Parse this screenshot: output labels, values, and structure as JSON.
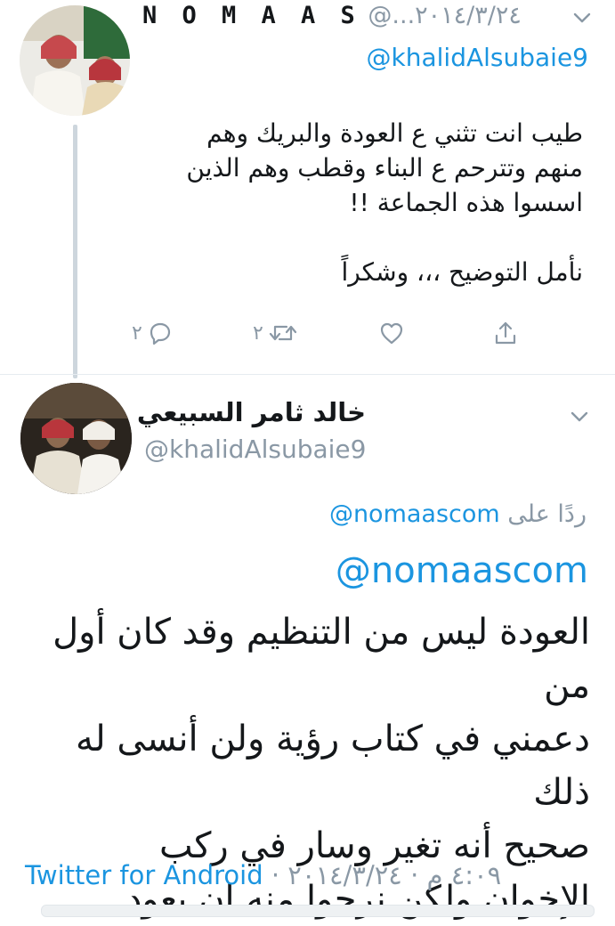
{
  "tweet1": {
    "display_name": "N O M A A S",
    "handle_and_date": "@...‏ ٢٠١٤/٣/٢٤",
    "reply_to_handle": "@khalidAlsubaie9",
    "body": "طيب انت تثني ع العودة والبريك وهم\nمنهم وتترحم ع البناء وقطب وهم الذين\nاسسوا هذه الجماعة !!\n\nنأمل التوضيح ،،، وشكراً",
    "actions": {
      "reply_count": "٢",
      "retweet_count": "٢",
      "like_count": "",
      "reply_icon": "reply-icon",
      "retweet_icon": "retweet-icon",
      "like_icon": "heart-icon",
      "share_icon": "share-icon"
    }
  },
  "tweet2": {
    "display_name": "خالد ثامر السبيعي",
    "handle": "@khalidAlsubaie9",
    "replying_prefix": "ردًا على",
    "replying_handle": "@nomaascom",
    "mention": "@nomaascom",
    "body": "العودة ليس من التنظيم وقد كان أول من\nدعمني في كتاب رؤية ولن أنسى له ذلك\nصحيح أنه تغير وسار في ركب\nالإخوان.ولكن نرجوا منه ان يعود",
    "time": "٤:٠٩ م",
    "date": "٢٠١٤/٣/٢٤",
    "separator": "·",
    "source": "Twitter for Android"
  },
  "colors": {
    "link": "#1b95e0",
    "muted": "#8a98a5",
    "text": "#14171a",
    "thread_line": "#cdd6dd"
  }
}
